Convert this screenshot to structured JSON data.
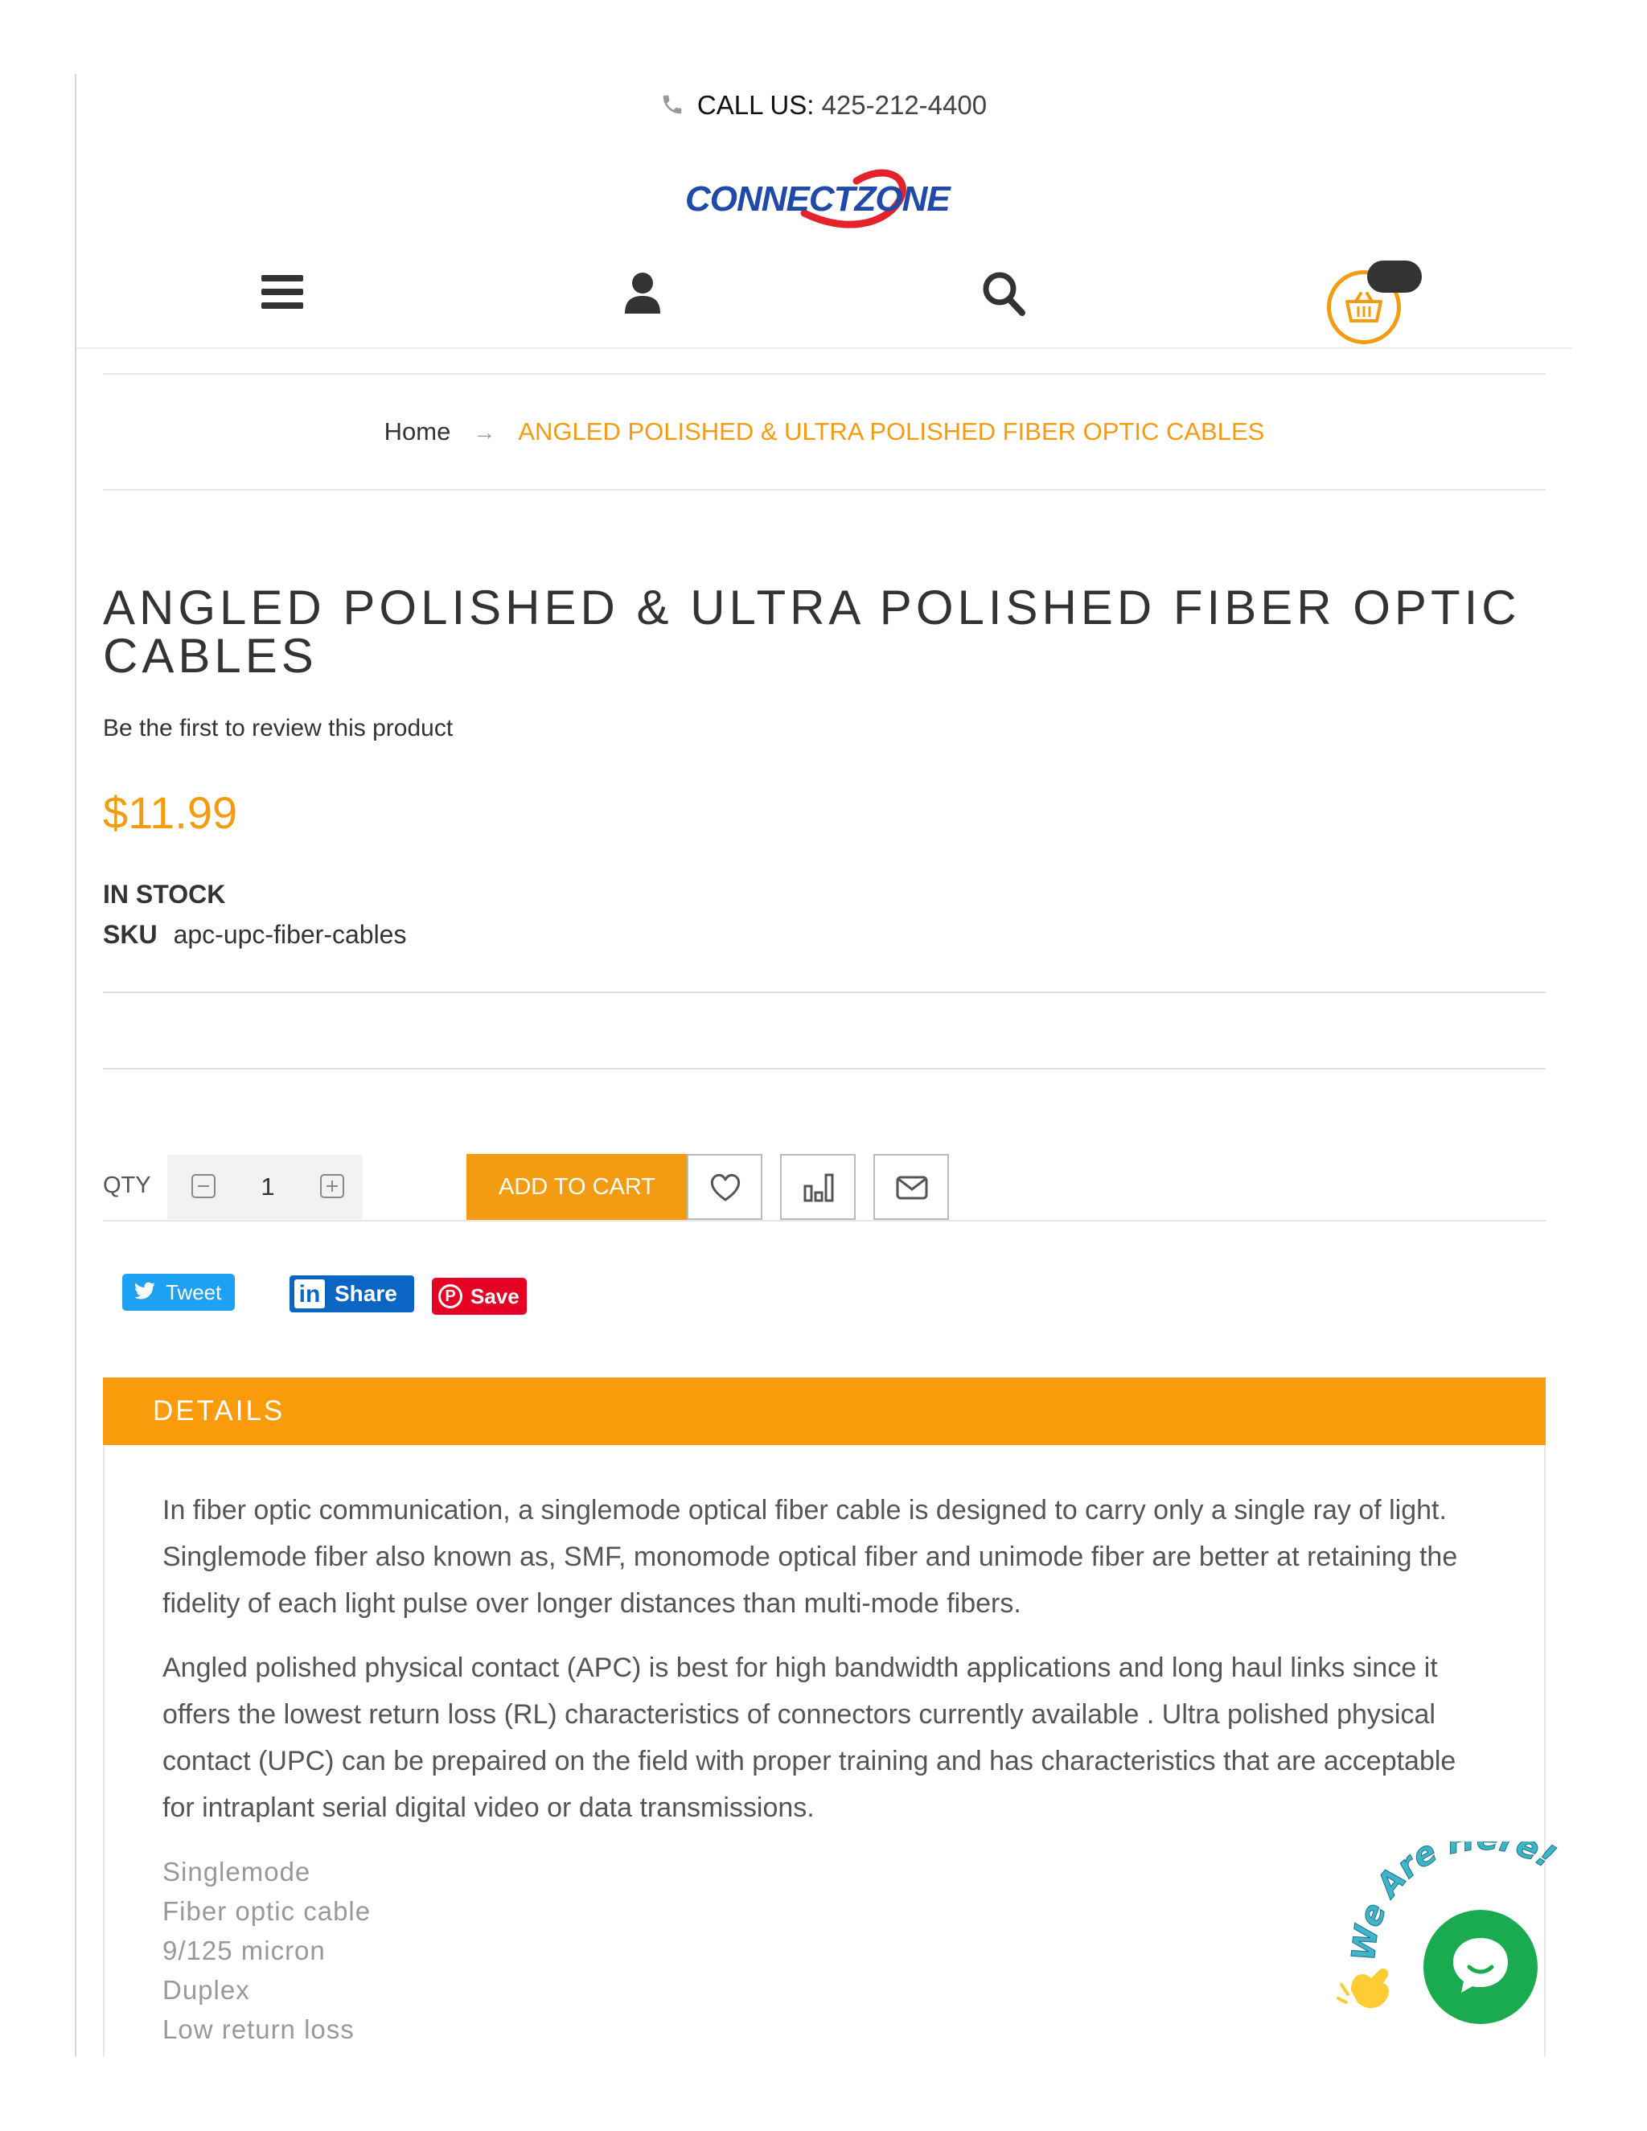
{
  "header": {
    "call_label": "CALL US:",
    "call_number": "425-212-4400",
    "logo_text": "CONNECTZONE"
  },
  "nav_icons": [
    "menu-icon",
    "user-icon",
    "search-icon",
    "cart-icon"
  ],
  "breadcrumb": {
    "home": "Home",
    "arrow": "→",
    "current": "ANGLED POLISHED & ULTRA POLISHED FIBER OPTIC CABLES"
  },
  "product": {
    "title": "ANGLED POLISHED & ULTRA POLISHED FIBER OPTIC CABLES",
    "review_link": "Be the first to review this product",
    "price": "$11.99",
    "stock": "IN STOCK",
    "sku_label": "SKU",
    "sku_value": "apc-upc-fiber-cables"
  },
  "purchase": {
    "qty_label": "QTY",
    "qty_value": "1",
    "add_to_cart": "ADD TO CART"
  },
  "social": {
    "tweet": "Tweet",
    "linkedin": "Share",
    "pinterest": "Save"
  },
  "details": {
    "header": "DETAILS",
    "paragraph_1": "In fiber optic communication, a singlemode optical fiber cable is designed to carry only a single ray of light. Singlemode fiber also known as, SMF, monomode optical fiber and unimode fiber are better at retaining the fidelity of each light pulse over longer distances than multi-mode fibers.",
    "paragraph_2": "Angled polished physical contact (APC) is best for high bandwidth applications and long haul links since it offers the lowest return loss (RL) characteristics of connectors currently available . Ultra polished physical contact (UPC) can be prepaired on the field with proper training and has characteristics that are acceptable for intraplant serial digital video or data transmissions.",
    "specs": [
      "Singlemode",
      "Fiber optic cable",
      "9/125 micron",
      "Duplex",
      "Low return loss"
    ]
  },
  "chat": {
    "label": "We Are Here!"
  },
  "colors": {
    "accent": "#f39c12",
    "details_bar": "#f99b0a",
    "chat": "#1aaa4f",
    "tweet": "#1da1f2",
    "linkedin": "#0a66c2",
    "pinterest": "#e60023"
  }
}
